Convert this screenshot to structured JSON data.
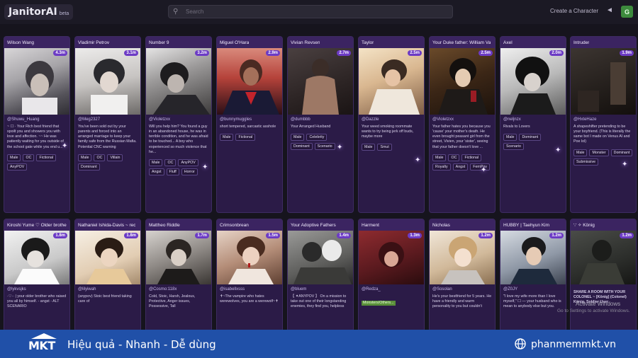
{
  "app": {
    "logo": "JanitorAI",
    "beta": "beta",
    "search_placeholder": "Search",
    "create_label": "Create a Character",
    "avatar_letter": "G",
    "colors": {
      "accent": "#6c3bc5",
      "card": "#2b1b47",
      "banner": "#2050a8"
    }
  },
  "cards": [
    {
      "name": "Wilson Wang",
      "count": "4.3m",
      "creator": "@Shuwu_Huang",
      "desc": "~ ☐ · Your Rich best friend that spoilt you and showers you with love and affection. ~~ He was patiently waiting for you outside of the school gate while you end u...",
      "tags": [
        "Male",
        "OC",
        "Fictional",
        "AnyPOV"
      ]
    },
    {
      "name": "Vladimir Petrov",
      "count": "3.1m",
      "creator": "@Meg2327",
      "desc": "You've been sold out by your parents and forced into an arranged marriage to keep your family safe from the Russian Mafia. Potential CNC warning",
      "tags": [
        "Male",
        "OC",
        "Villain",
        "Dominant"
      ]
    },
    {
      "name": "Number 9",
      "count": "3.2m",
      "creator": "@Violetzxx",
      "desc": "Will you help him? You found a guy in an abandoned house, he was in terrible condition, and he was afraid to be touched... A boy who experienced so much violence that he...",
      "tags": [
        "Male",
        "OC",
        "AnyPOV",
        "Angst",
        "Fluff",
        "Horror"
      ]
    },
    {
      "name": "Miguel O'Hara",
      "count": "2.9m",
      "creator": "@bunnymuggles",
      "desc": "short tempered, sarcastic asshole",
      "tags": [
        "Male",
        "Fictional"
      ]
    },
    {
      "name": "Vivian Revsen",
      "count": "2.7m",
      "creator": "@dumbbb",
      "desc": "Your Arranged Husband",
      "tags": [
        "Male",
        "Celebrity",
        "Dominant",
        "Scenario"
      ]
    },
    {
      "name": "Taylor",
      "count": "2.5m",
      "creator": "@Dazzle",
      "desc": "Your weed smoking roommate wants to try being jerk off buds, maybe more",
      "tags": [
        "Male",
        "Smut"
      ]
    },
    {
      "name": "Your Duke father: William Va",
      "count": "2.5m",
      "creator": "@Violetzxx",
      "desc": "Your father hates you because you 'cause' your mother's death. He even brought peasant girl from the street, Vivien, your 'sister', seeing that your father doesn't love ...",
      "tags": [
        "Male",
        "OC",
        "Fictional",
        "Royalty",
        "Angst",
        "FemPov"
      ]
    },
    {
      "name": "Axel",
      "count": "2.0m",
      "creator": "@neljnzx",
      "desc": "Rivals to Lovers",
      "tags": [
        "Male",
        "Dominant",
        "Scenario"
      ]
    },
    {
      "name": "Intruder",
      "count": "1.9m",
      "creator": "@HxteHaze",
      "desc": "A shapeshifter pretending to be your boyfriend. (This is literally the same bot I made on Venus AI and Poe lol)",
      "tags": [
        "Male",
        "Monster",
        "Dominant",
        "Submissive"
      ]
    },
    {
      "name": "Kiroshi Yume ♡ Older brothe",
      "count": "1.8m",
      "creator": "@lykvsjks",
      "desc": "·♡·· | your older brother who raised you all by himself. - angst - ALT SCENARIO",
      "tags": []
    },
    {
      "name": "Nathaniel Ishida-Davis ~ rec",
      "count": "1.8m",
      "creator": "@lilyiwah",
      "desc": "(anypov) Stoic best friend taking care of",
      "tags": []
    },
    {
      "name": "Mattheo Riddle",
      "count": "1.7m",
      "creator": "@Cosmo:118x",
      "desc": "Cold, Stoic, Harsh, Jealous, Protective, Anger issues, Possessive, Tall",
      "tags": []
    },
    {
      "name": "Crimsonbrean",
      "count": "1.5m",
      "creator": "@isabellxsss",
      "desc": "✝~The vampire who hates werewolves, you are a werewolf~✝",
      "tags": []
    },
    {
      "name": "Your Adoptive Fathers",
      "count": "1.4m",
      "creator": "@bluem",
      "desc": "【 ✦ANYPOV 】 On a mission to take out one of their longstanding enemies, they find you, helpless",
      "tags": []
    },
    {
      "name": "Harment",
      "count": "1.3m",
      "creator": "@Redza_",
      "desc": "Monsters/Others...",
      "tags": []
    },
    {
      "name": "Nicholas",
      "count": "1.2m",
      "creator": "@Sosolan",
      "desc": "He's your bestfriend for 5 years. He have a friendly and warm personality to you but couldn't",
      "tags": []
    },
    {
      "name": "HUBBY | Taehyun Kim",
      "count": "1.2m",
      "creator": "@Z0JY",
      "desc": "\"I love my wife more than I love myself,\" ☐ — your husband who is mean to anybody else but you.",
      "tags": []
    },
    {
      "name": "∵ ✧ König",
      "count": "1.2m",
      "creator": "",
      "desc": "SHARE A ROOM WITH YOUR COLONEL ~ [König] (Colonel) König, Soldier User",
      "tags": []
    }
  ],
  "watermark": {
    "line1": "Activate Windows",
    "line2": "Go to Settings to activate Windows."
  },
  "banner": {
    "logo": "MKT",
    "tagline": "Hiệu quả - Nhanh - Dễ dùng",
    "site": "phanmemmkt.vn"
  }
}
